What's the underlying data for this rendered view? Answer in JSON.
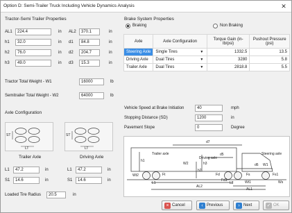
{
  "window": {
    "title": "Option D: Semi-Trailer Truck Including Vehicle Dynamics Analysis",
    "close_glyph": "✕"
  },
  "tractor": {
    "title": "Tractor-Semi Trailer Properties",
    "rows": [
      {
        "l1": "AL1",
        "v1": "224.4",
        "u1": "in",
        "l2": "AL2",
        "v2": "370.1",
        "u2": "in"
      },
      {
        "l1": "h1",
        "v1": "32.0",
        "u1": "in",
        "l2": "d1",
        "v2": "84.8",
        "u2": "in"
      },
      {
        "l1": "h2",
        "v1": "76.0",
        "u1": "in",
        "l2": "d2",
        "v2": "204.7",
        "u2": "in"
      },
      {
        "l1": "h3",
        "v1": "49.0",
        "u1": "in",
        "l2": "d3",
        "v2": "15.3",
        "u2": "in"
      }
    ],
    "w1_label": "Tractor Total Weight - W1",
    "w1_value": "16000",
    "w1_unit": "lb",
    "w2_label": "Semitrailer Total Weight - W2",
    "w2_value": "64000",
    "w2_unit": "lb"
  },
  "axle_config": {
    "title": "Axle Configuration",
    "trailer_label": "Trailer Axle",
    "driving_label": "Driving Axle",
    "lt_mark": "LT",
    "st_mark": "ST",
    "l_label_a": "L1",
    "l_value_a": "47.2",
    "l_unit_a": "in",
    "l_label_b": "L1",
    "l_value_b": "47.2",
    "l_unit_b": "in",
    "s_label_a": "S1",
    "s_value_a": "14.6",
    "s_unit_a": "in",
    "s_label_b": "S1",
    "s_value_b": "14.6",
    "s_unit_b": "in",
    "tire_label": "Loaded Tire Radius",
    "tire_value": "20.5",
    "tire_unit": "in"
  },
  "brake": {
    "title": "Brake System Properties",
    "radio_braking": "Braking",
    "radio_non_braking": "Non Braking",
    "headers": [
      "Axle",
      "Axle Configuration",
      "Torque Gain (in-lb/psi)",
      "Pushout Pressure (psi)"
    ],
    "rows": [
      {
        "axle": "Steering Axle",
        "config": "Single Tires",
        "torque": "1332.5",
        "pushout": "13.5"
      },
      {
        "axle": "Driving Axle",
        "config": "Dual Tires",
        "torque": "3280",
        "pushout": "5.8"
      },
      {
        "axle": "Trailer Axle",
        "config": "Dual Tires",
        "torque": "2818.8",
        "pushout": "5.5"
      }
    ]
  },
  "dynamics": {
    "speed_label": "Vehicle Speed at Brake Initiation",
    "speed_value": "40",
    "speed_unit": "mph",
    "distance_label": "Stopping Distance (SD)",
    "distance_value": "1200",
    "distance_unit": "in",
    "slope_label": "Pavement Slope",
    "slope_value": "0",
    "slope_unit": "Degree"
  },
  "diagram": {
    "labels": {
      "trailer_axle": "Trailer axle",
      "driving_axle": "Driving axle",
      "steering_axle": "Steering axle",
      "d7": "d7",
      "d5": "d5",
      "d6": "d6",
      "w2": "W2",
      "w1": "W1",
      "h1": "h1",
      "h2": "h2",
      "h3": "h3",
      "fs": "Fs",
      "ft": "Ft",
      "fd": "Fd",
      "fd1": "Fd1",
      "fsr": "Fs1",
      "ws": "Ws",
      "l1": "L1",
      "l2": "L2",
      "al1": "AL1",
      "al2": "AL2",
      "wt1": "Wt1",
      "wt2": "Wt2"
    }
  },
  "buttons": {
    "cancel": "Cancel",
    "previous": "Previous",
    "next": "Next",
    "ok": "OK"
  },
  "colors": {
    "selection": "#3a8ee6",
    "cancel_icon": "#d9534f",
    "nav_icon": "#2f7fd0"
  }
}
